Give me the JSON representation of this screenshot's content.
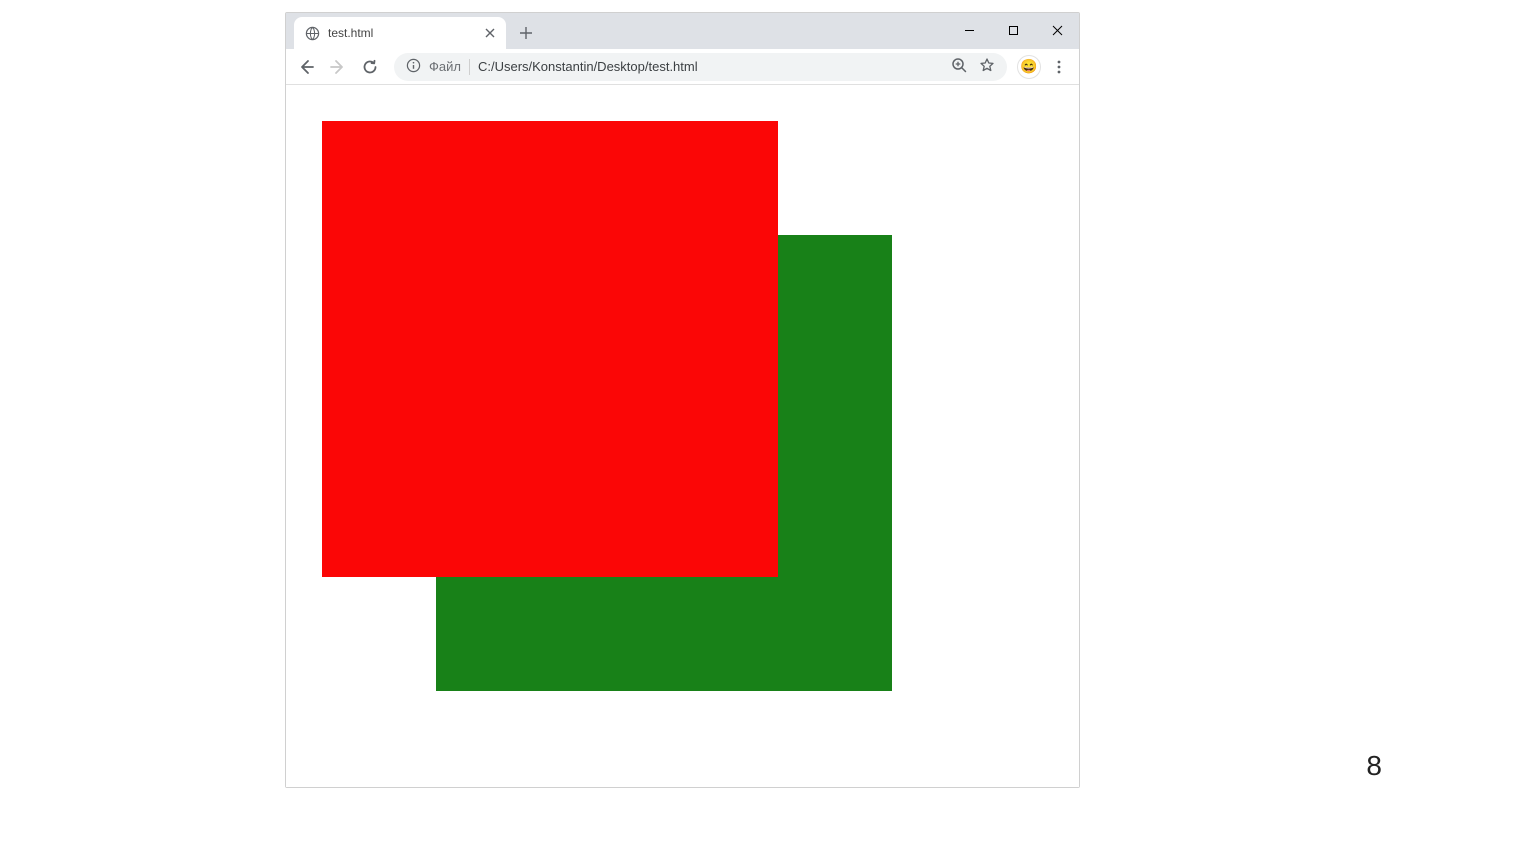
{
  "window": {
    "tab_title": "test.html",
    "close_icon": "close",
    "new_tab_icon": "plus"
  },
  "toolbar": {
    "address_label": "Файл",
    "url": "C:/Users/Konstantin/Desktop/test.html",
    "profile_emoji": "😄"
  },
  "content": {
    "colors": {
      "red": "#fb0606",
      "green": "#188118"
    }
  },
  "slide": {
    "page_number": "8"
  }
}
